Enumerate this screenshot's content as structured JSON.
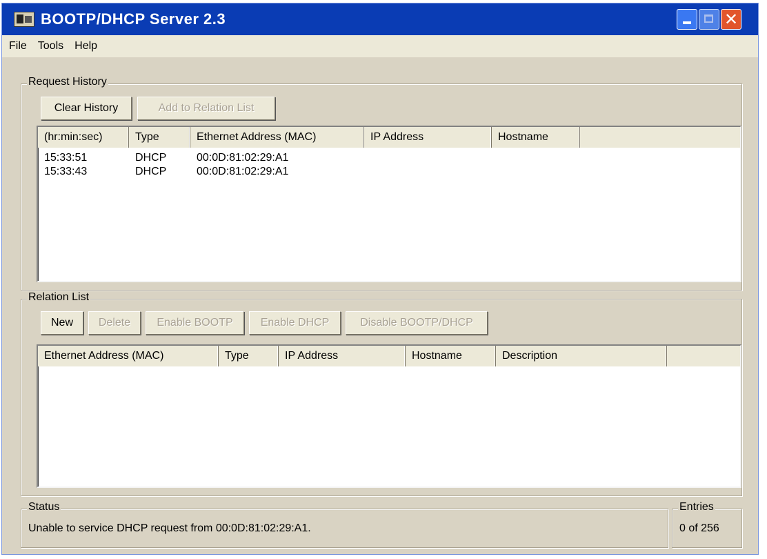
{
  "window": {
    "title": "BOOTP/DHCP Server 2.3",
    "close_glyph": "✕"
  },
  "menu": [
    "File",
    "Tools",
    "Help"
  ],
  "request_history": {
    "label": "Request History",
    "buttons": {
      "clear": "Clear History",
      "add": "Add to Relation List"
    },
    "columns": [
      "(hr:min:sec)",
      "Type",
      "Ethernet Address (MAC)",
      "IP Address",
      "Hostname"
    ],
    "rows": [
      {
        "time": "15:33:51",
        "type": "DHCP",
        "mac": "00:0D:81:02:29:A1",
        "ip": "",
        "hostname": ""
      },
      {
        "time": "15:33:43",
        "type": "DHCP",
        "mac": "00:0D:81:02:29:A1",
        "ip": "",
        "hostname": ""
      }
    ]
  },
  "relation_list": {
    "label": "Relation List",
    "buttons": {
      "new": "New",
      "delete": "Delete",
      "enable_bootp": "Enable BOOTP",
      "enable_dhcp": "Enable DHCP",
      "disable": "Disable BOOTP/DHCP"
    },
    "columns": [
      "Ethernet Address (MAC)",
      "Type",
      "IP Address",
      "Hostname",
      "Description"
    ]
  },
  "status": {
    "label": "Status",
    "text": "Unable to service DHCP request from 00:0D:81:02:29:A1."
  },
  "entries": {
    "label": "Entries",
    "text": "0 of 256"
  },
  "colors": {
    "titlebar": "#0a3cb4",
    "window_bg": "#d9d3c3",
    "disabled_text": "#a9a294"
  },
  "icons": [
    "app-icon",
    "minimize-icon",
    "maximize-icon",
    "close-icon"
  ]
}
